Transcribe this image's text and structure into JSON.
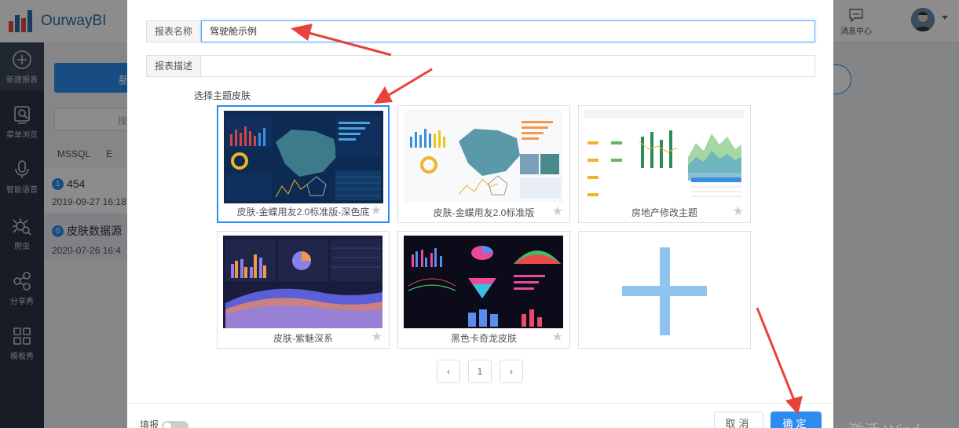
{
  "app": {
    "brand": "OurwayBI"
  },
  "sidebar": {
    "items": [
      {
        "label": "新建报表",
        "icon": "plus-circle-icon"
      },
      {
        "label": "菜单浏览",
        "icon": "search-doc-icon"
      },
      {
        "label": "智能语音",
        "icon": "microphone-icon"
      },
      {
        "label": "爬虫",
        "icon": "spider-icon"
      },
      {
        "label": "分享秀",
        "icon": "share-icon"
      },
      {
        "label": "模板秀",
        "icon": "grid-icon"
      }
    ]
  },
  "header": {
    "message_center": "消息中心"
  },
  "background_page": {
    "new_button": "新",
    "search_text": "搜",
    "tabs": [
      "MSSQL",
      "E"
    ],
    "list": [
      {
        "badge": "1",
        "title": "454",
        "date": "2019-09-27 16:18"
      },
      {
        "badge": "0",
        "title": "皮肤数据源",
        "date": "2020-07-26 16:4"
      }
    ],
    "watermark": "激活 Wind"
  },
  "dialog": {
    "name_label": "报表名称",
    "name_value": "驾驶舱示例",
    "desc_label": "报表描述",
    "desc_value": "",
    "skin_title": "选择主题皮肤",
    "skins": [
      {
        "label": "皮肤-金蝶用友2.0标准版-深色底",
        "theme": "dark-blue",
        "selected": true
      },
      {
        "label": "皮肤-金蝶用友2.0标准版",
        "theme": "light",
        "selected": false
      },
      {
        "label": "房地产修改主题",
        "theme": "realestate",
        "selected": false
      },
      {
        "label": "皮肤-紫魅深系",
        "theme": "purple",
        "selected": false
      },
      {
        "label": "黑色卡奇龙皮肤",
        "theme": "black",
        "selected": false
      },
      {
        "label": "",
        "theme": "add",
        "selected": false
      }
    ],
    "pagination": {
      "prev": "‹",
      "page": "1",
      "next": "›"
    },
    "fill_label": "填报",
    "cancel": "取消",
    "confirm": "确定"
  }
}
